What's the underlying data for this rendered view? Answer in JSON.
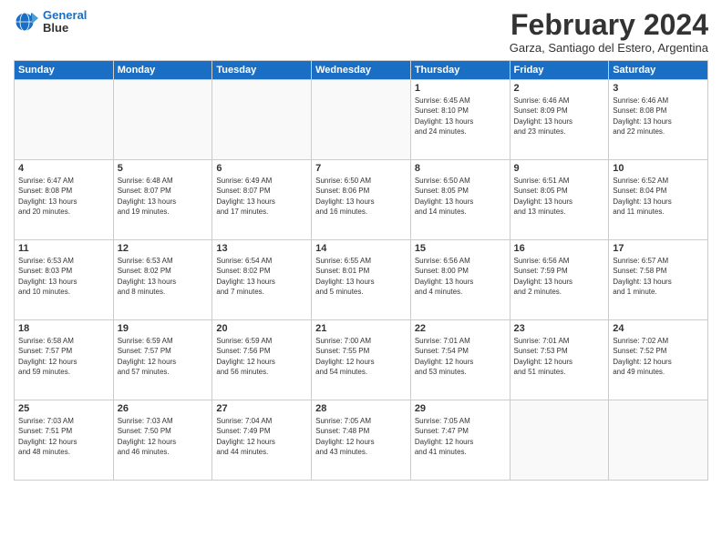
{
  "logo": {
    "line1": "General",
    "line2": "Blue"
  },
  "title": "February 2024",
  "subtitle": "Garza, Santiago del Estero, Argentina",
  "headers": [
    "Sunday",
    "Monday",
    "Tuesday",
    "Wednesday",
    "Thursday",
    "Friday",
    "Saturday"
  ],
  "weeks": [
    [
      {
        "day": "",
        "info": ""
      },
      {
        "day": "",
        "info": ""
      },
      {
        "day": "",
        "info": ""
      },
      {
        "day": "",
        "info": ""
      },
      {
        "day": "1",
        "info": "Sunrise: 6:45 AM\nSunset: 8:10 PM\nDaylight: 13 hours\nand 24 minutes."
      },
      {
        "day": "2",
        "info": "Sunrise: 6:46 AM\nSunset: 8:09 PM\nDaylight: 13 hours\nand 23 minutes."
      },
      {
        "day": "3",
        "info": "Sunrise: 6:46 AM\nSunset: 8:08 PM\nDaylight: 13 hours\nand 22 minutes."
      }
    ],
    [
      {
        "day": "4",
        "info": "Sunrise: 6:47 AM\nSunset: 8:08 PM\nDaylight: 13 hours\nand 20 minutes."
      },
      {
        "day": "5",
        "info": "Sunrise: 6:48 AM\nSunset: 8:07 PM\nDaylight: 13 hours\nand 19 minutes."
      },
      {
        "day": "6",
        "info": "Sunrise: 6:49 AM\nSunset: 8:07 PM\nDaylight: 13 hours\nand 17 minutes."
      },
      {
        "day": "7",
        "info": "Sunrise: 6:50 AM\nSunset: 8:06 PM\nDaylight: 13 hours\nand 16 minutes."
      },
      {
        "day": "8",
        "info": "Sunrise: 6:50 AM\nSunset: 8:05 PM\nDaylight: 13 hours\nand 14 minutes."
      },
      {
        "day": "9",
        "info": "Sunrise: 6:51 AM\nSunset: 8:05 PM\nDaylight: 13 hours\nand 13 minutes."
      },
      {
        "day": "10",
        "info": "Sunrise: 6:52 AM\nSunset: 8:04 PM\nDaylight: 13 hours\nand 11 minutes."
      }
    ],
    [
      {
        "day": "11",
        "info": "Sunrise: 6:53 AM\nSunset: 8:03 PM\nDaylight: 13 hours\nand 10 minutes."
      },
      {
        "day": "12",
        "info": "Sunrise: 6:53 AM\nSunset: 8:02 PM\nDaylight: 13 hours\nand 8 minutes."
      },
      {
        "day": "13",
        "info": "Sunrise: 6:54 AM\nSunset: 8:02 PM\nDaylight: 13 hours\nand 7 minutes."
      },
      {
        "day": "14",
        "info": "Sunrise: 6:55 AM\nSunset: 8:01 PM\nDaylight: 13 hours\nand 5 minutes."
      },
      {
        "day": "15",
        "info": "Sunrise: 6:56 AM\nSunset: 8:00 PM\nDaylight: 13 hours\nand 4 minutes."
      },
      {
        "day": "16",
        "info": "Sunrise: 6:56 AM\nSunset: 7:59 PM\nDaylight: 13 hours\nand 2 minutes."
      },
      {
        "day": "17",
        "info": "Sunrise: 6:57 AM\nSunset: 7:58 PM\nDaylight: 13 hours\nand 1 minute."
      }
    ],
    [
      {
        "day": "18",
        "info": "Sunrise: 6:58 AM\nSunset: 7:57 PM\nDaylight: 12 hours\nand 59 minutes."
      },
      {
        "day": "19",
        "info": "Sunrise: 6:59 AM\nSunset: 7:57 PM\nDaylight: 12 hours\nand 57 minutes."
      },
      {
        "day": "20",
        "info": "Sunrise: 6:59 AM\nSunset: 7:56 PM\nDaylight: 12 hours\nand 56 minutes."
      },
      {
        "day": "21",
        "info": "Sunrise: 7:00 AM\nSunset: 7:55 PM\nDaylight: 12 hours\nand 54 minutes."
      },
      {
        "day": "22",
        "info": "Sunrise: 7:01 AM\nSunset: 7:54 PM\nDaylight: 12 hours\nand 53 minutes."
      },
      {
        "day": "23",
        "info": "Sunrise: 7:01 AM\nSunset: 7:53 PM\nDaylight: 12 hours\nand 51 minutes."
      },
      {
        "day": "24",
        "info": "Sunrise: 7:02 AM\nSunset: 7:52 PM\nDaylight: 12 hours\nand 49 minutes."
      }
    ],
    [
      {
        "day": "25",
        "info": "Sunrise: 7:03 AM\nSunset: 7:51 PM\nDaylight: 12 hours\nand 48 minutes."
      },
      {
        "day": "26",
        "info": "Sunrise: 7:03 AM\nSunset: 7:50 PM\nDaylight: 12 hours\nand 46 minutes."
      },
      {
        "day": "27",
        "info": "Sunrise: 7:04 AM\nSunset: 7:49 PM\nDaylight: 12 hours\nand 44 minutes."
      },
      {
        "day": "28",
        "info": "Sunrise: 7:05 AM\nSunset: 7:48 PM\nDaylight: 12 hours\nand 43 minutes."
      },
      {
        "day": "29",
        "info": "Sunrise: 7:05 AM\nSunset: 7:47 PM\nDaylight: 12 hours\nand 41 minutes."
      },
      {
        "day": "",
        "info": ""
      },
      {
        "day": "",
        "info": ""
      }
    ]
  ]
}
